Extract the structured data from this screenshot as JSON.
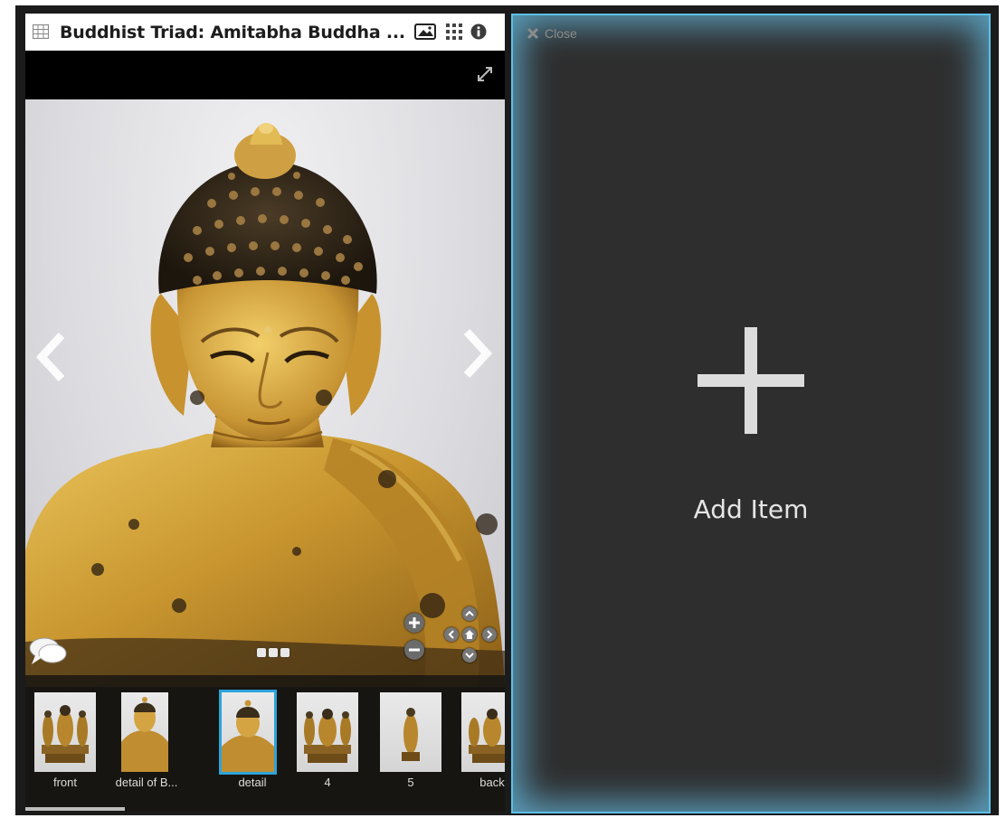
{
  "viewer": {
    "title": "Buddhist Triad: Amitabha Buddha ...",
    "icons": [
      "grid-table-icon",
      "image-view-icon",
      "gallery-grid-icon",
      "info-icon"
    ],
    "thumbnails": [
      {
        "label": "front",
        "selected": false
      },
      {
        "label": "detail of B...",
        "selected": false
      },
      {
        "label": "detail",
        "selected": true
      },
      {
        "label": "4",
        "selected": false
      },
      {
        "label": "5",
        "selected": false
      },
      {
        "label": "back",
        "selected": false
      }
    ]
  },
  "add_panel": {
    "close_label": "Close",
    "add_label": "Add Item"
  },
  "colors": {
    "accent": "#2ea3d9",
    "glow": "#5cc0e6",
    "panel_bg": "#2e2e2e"
  }
}
